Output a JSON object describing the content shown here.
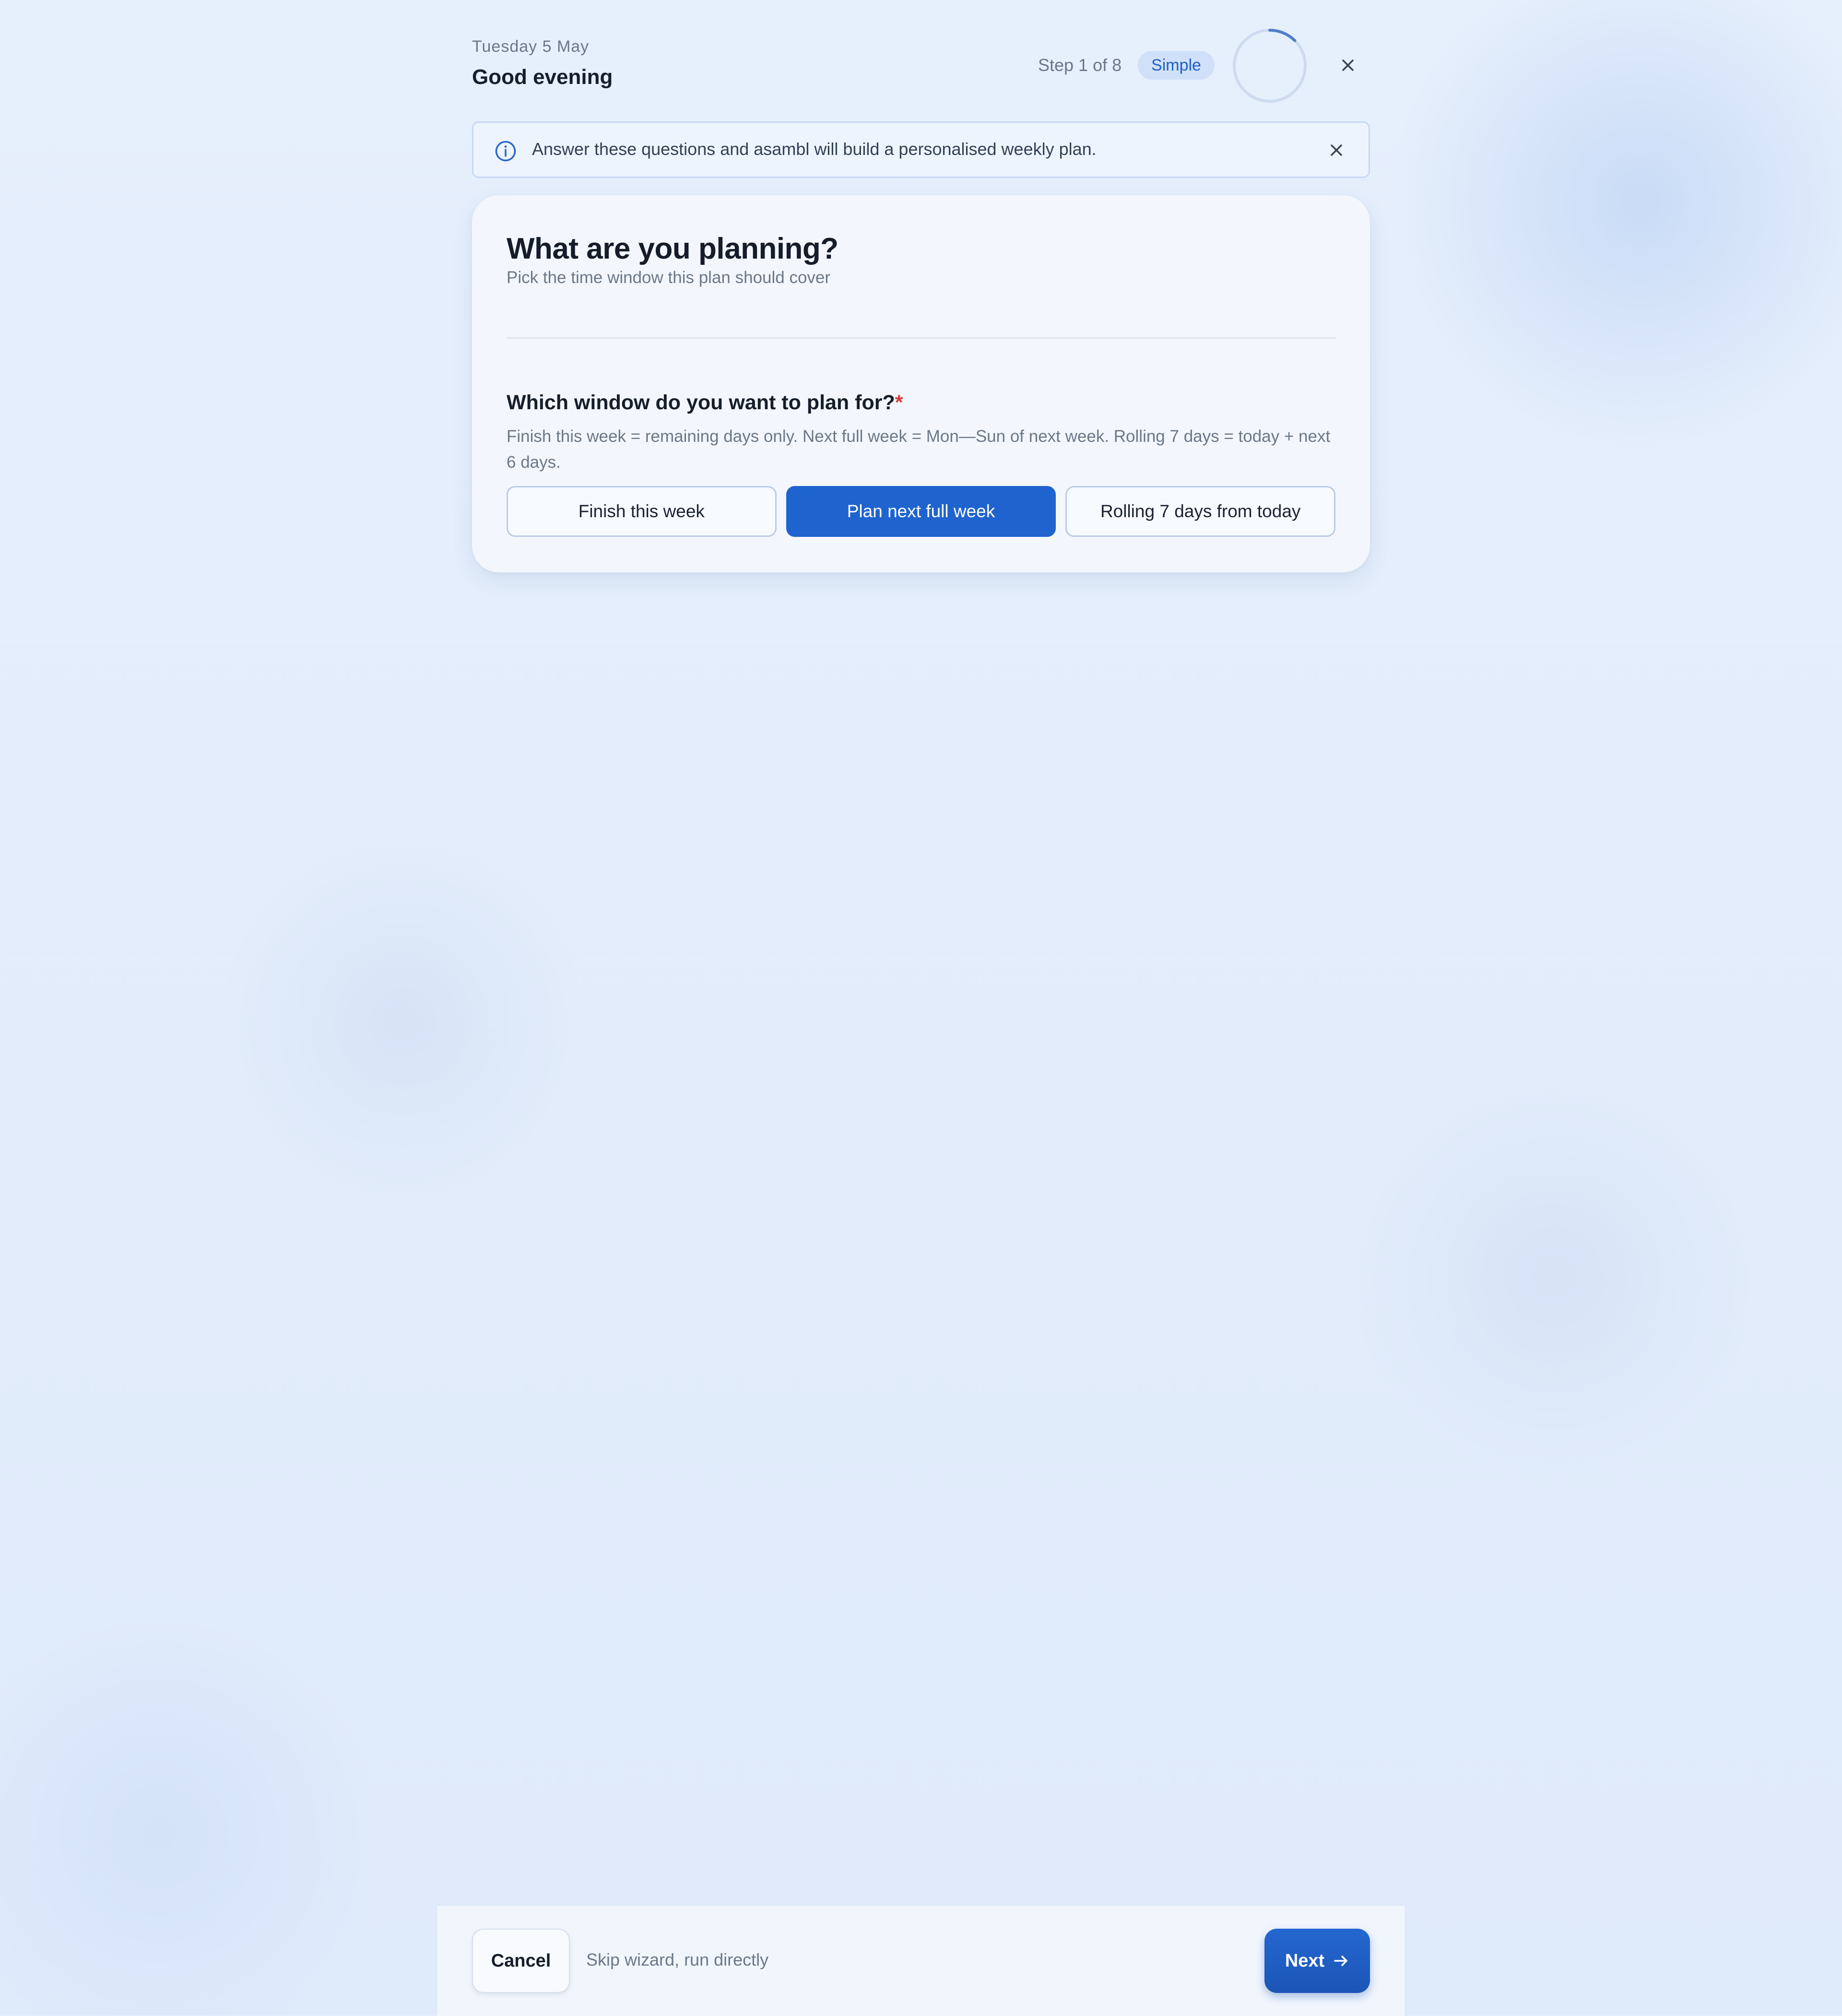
{
  "header": {
    "date": "Tuesday 5 May",
    "greeting": "Good evening",
    "step_text": "Step 1 of 8",
    "mode_badge": "Simple",
    "progress": {
      "current_step": 1,
      "total_steps": 8
    }
  },
  "info_banner": {
    "text": "Answer these questions and asambl will build a personalised weekly plan.",
    "icon": "info-icon"
  },
  "card": {
    "title": "What are you planning?",
    "subtitle": "Pick the time window this plan should cover",
    "question": {
      "label": "Which window do you want to plan for?",
      "required_mark": "*",
      "help": "Finish this week = remaining days only. Next full week = Mon—Sun of next week. Rolling 7 days = today + next 6 days.",
      "options": [
        {
          "label": "Finish this week",
          "selected": false
        },
        {
          "label": "Plan next full week",
          "selected": true
        },
        {
          "label": "Rolling 7 days from today",
          "selected": false
        }
      ]
    }
  },
  "footer": {
    "cancel_label": "Cancel",
    "skip_label": "Skip wizard, run directly",
    "next_label": "Next",
    "next_icon": "arrow-right-icon"
  },
  "colors": {
    "accent": "#1f63cf",
    "badge_bg": "#cfe0f8",
    "required": "#d93b3b",
    "background": "#e4eefc"
  }
}
